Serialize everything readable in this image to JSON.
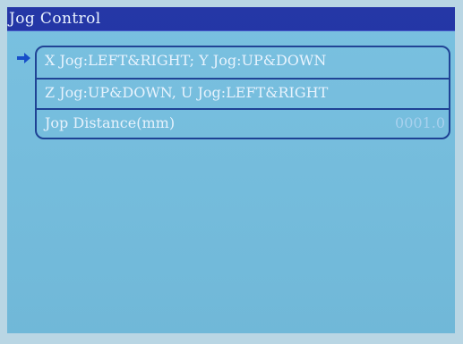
{
  "title_bar": {
    "title": "Jog Control"
  },
  "menu": {
    "selected_index": 0,
    "items": [
      {
        "label": "X Jog:LEFT&RIGHT; Y Jog:UP&DOWN"
      },
      {
        "label": "Z Jog:UP&DOWN, U Jog:LEFT&RIGHT"
      },
      {
        "label": "Jop Distance(mm)",
        "value": "0001.0"
      }
    ]
  },
  "icons": {
    "selection_arrow": "arrow-right-icon"
  },
  "colors": {
    "screen_background": "#74bedf",
    "title_bar_background": "#1c2fa3",
    "menu_border": "#193e93",
    "text": "#e8f4ff",
    "arrow": "#0f49c8"
  }
}
